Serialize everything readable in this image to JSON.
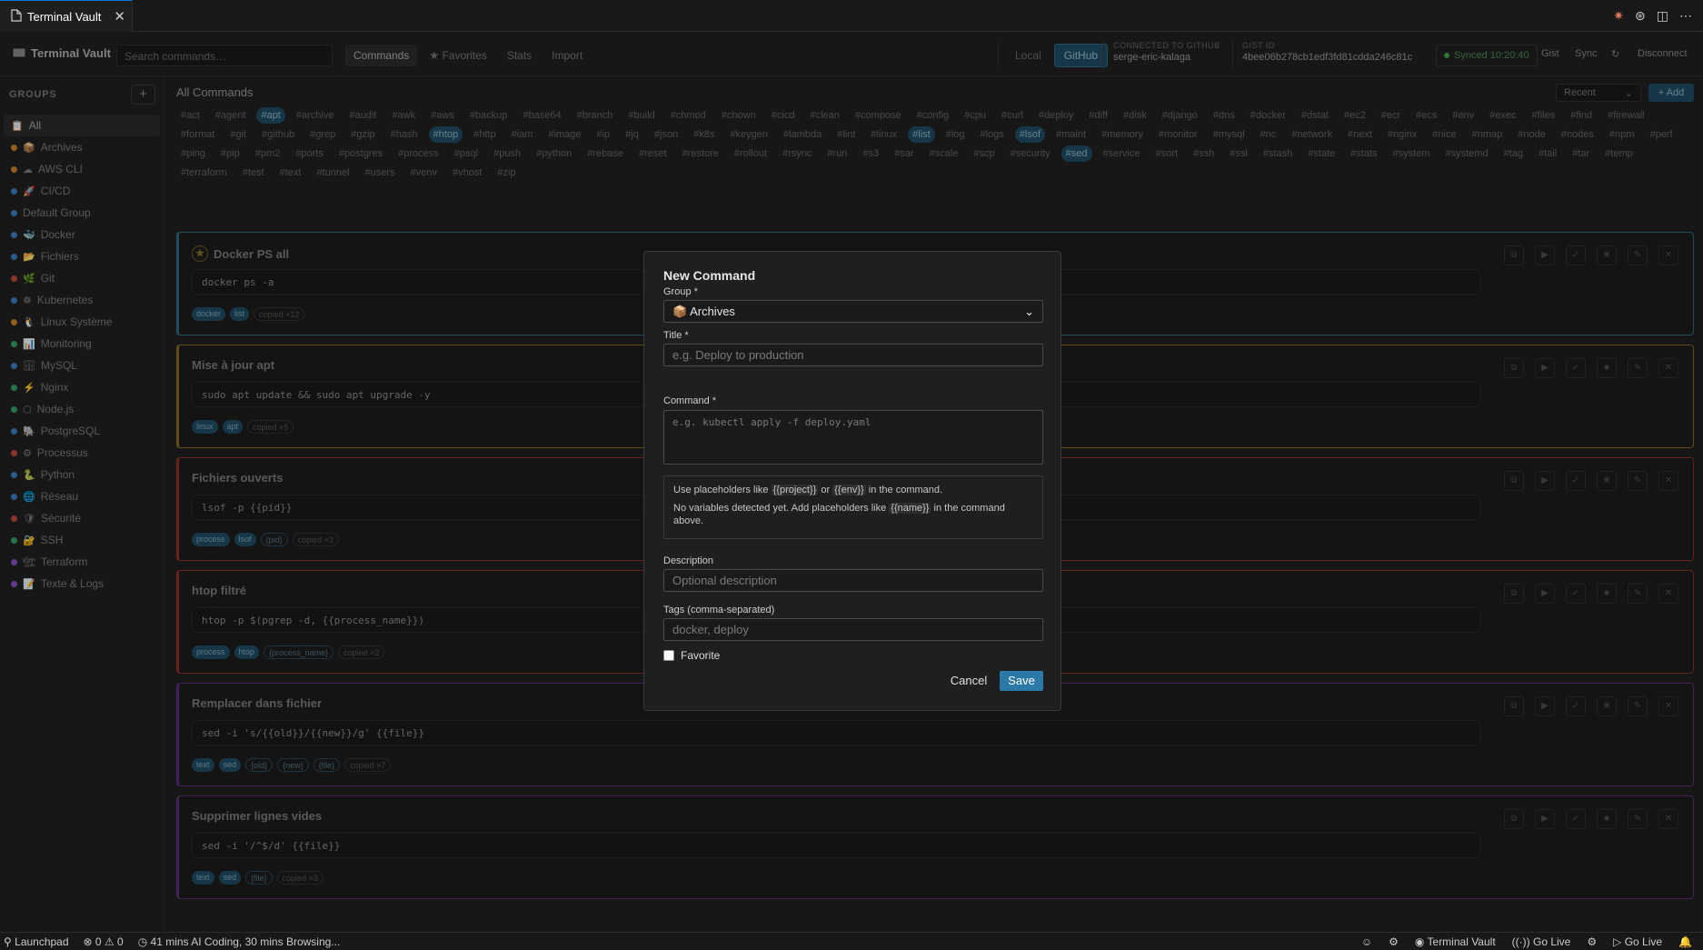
{
  "window": {
    "tab_title": "Terminal Vault",
    "tab_close": "✕"
  },
  "toolbar": {
    "brand": "Terminal Vault",
    "search_placeholder": "Search commands…",
    "tabs": [
      "Commands",
      "★ Favorites",
      "Stats",
      "Import"
    ],
    "modes": [
      "Local",
      "GitHub"
    ],
    "connected_label": "CONNECTED TO GITHUB",
    "connected_user": "serge-eric-kalaga",
    "gist_label": "GIST ID",
    "gist_id": "4bee06b278cb1edf3fd81cdda246c81c",
    "synced": "Synced 10:20:40",
    "actions": [
      "Gist",
      "Sync",
      "↻",
      "Disconnect"
    ]
  },
  "sidebar": {
    "heading": "GROUPS",
    "add": "+",
    "items": [
      {
        "label": "All",
        "icon": "📋",
        "color": ""
      },
      {
        "label": "Archives",
        "icon": "📦",
        "color": "#c9822b"
      },
      {
        "label": "AWS CLI",
        "icon": "☁",
        "color": "#c9822b"
      },
      {
        "label": "CI/CD",
        "icon": "🚀",
        "color": "#3d7ec2"
      },
      {
        "label": "Default Group",
        "icon": "",
        "color": "#3d7ec2"
      },
      {
        "label": "Docker",
        "icon": "🐳",
        "color": "#3d7ec2"
      },
      {
        "label": "Fichiers",
        "icon": "📂",
        "color": "#3d7ec2"
      },
      {
        "label": "Git",
        "icon": "🌿",
        "color": "#c04a3a"
      },
      {
        "label": "Kubernetes",
        "icon": "☸",
        "color": "#3d7ec2"
      },
      {
        "label": "Linux Système",
        "icon": "🐧",
        "color": "#c9822b"
      },
      {
        "label": "Monitoring",
        "icon": "📊",
        "color": "#3aa06a"
      },
      {
        "label": "MySQL",
        "icon": "🗄",
        "color": "#3d7ec2"
      },
      {
        "label": "Nginx",
        "icon": "⚡",
        "color": "#3aa06a"
      },
      {
        "label": "Node.js",
        "icon": "⬡",
        "color": "#3aa06a"
      },
      {
        "label": "PostgreSQL",
        "icon": "🐘",
        "color": "#3d7ec2"
      },
      {
        "label": "Processus",
        "icon": "⚙",
        "color": "#c04a3a"
      },
      {
        "label": "Python",
        "icon": "🐍",
        "color": "#3d7ec2"
      },
      {
        "label": "Réseau",
        "icon": "🌐",
        "color": "#3d7ec2"
      },
      {
        "label": "Sécurité",
        "icon": "🛡",
        "color": "#c04a3a"
      },
      {
        "label": "SSH",
        "icon": "🔐",
        "color": "#3aa06a"
      },
      {
        "label": "Terraform",
        "icon": "🏗",
        "color": "#8a4fc2"
      },
      {
        "label": "Texte & Logs",
        "icon": "📝",
        "color": "#8a4fc2"
      }
    ]
  },
  "main": {
    "title": "All Commands",
    "sort": "Recent",
    "add": "+ Add",
    "tags": [
      "#act",
      "#agent",
      "#apt",
      "#archive",
      "#audit",
      "#awk",
      "#aws",
      "#backup",
      "#base64",
      "#branch",
      "#build",
      "#chmod",
      "#chown",
      "#cicd",
      "#clean",
      "#compose",
      "#config",
      "#cpu",
      "#curl",
      "#deploy",
      "#diff",
      "#disk",
      "#django",
      "#dns",
      "#docker",
      "#dstat",
      "#ec2",
      "#ecr",
      "#ecs",
      "#env",
      "#exec",
      "#files",
      "#find",
      "#firewall",
      "#format",
      "#git",
      "#github",
      "#grep",
      "#gzip",
      "#hash",
      "#htop",
      "#http",
      "#iam",
      "#image",
      "#ip",
      "#jq",
      "#json",
      "#k8s",
      "#keygen",
      "#lambda",
      "#lint",
      "#linux",
      "#list",
      "#log",
      "#logs",
      "#lsof",
      "#maint",
      "#memory",
      "#monitor",
      "#mysql",
      "#nc",
      "#network",
      "#next",
      "#nginx",
      "#nice",
      "#nmap",
      "#node",
      "#nodes",
      "#npm",
      "#perf",
      "#ping",
      "#pip",
      "#pm2",
      "#ports",
      "#postgres",
      "#process",
      "#psql",
      "#push",
      "#python",
      "#rebase",
      "#reset",
      "#restore",
      "#rollout",
      "#rsync",
      "#run",
      "#s3",
      "#sar",
      "#scale",
      "#scp",
      "#security",
      "#sed",
      "#service",
      "#sort",
      "#ssh",
      "#ssl",
      "#stash",
      "#state",
      "#stats",
      "#system",
      "#systemd",
      "#tag",
      "#tail",
      "#tar",
      "#temp",
      "#terraform",
      "#test",
      "#text",
      "#tunnel",
      "#users",
      "#venv",
      "#vhost",
      "#zip"
    ],
    "selected_tags": [
      "#apt",
      "#htop",
      "#list",
      "#lsof",
      "#sed"
    ],
    "cards": [
      {
        "title": "Docker PS all",
        "fav": true,
        "accent": "#2c6a86",
        "cmd": "docker ps -a",
        "chips": [
          "docker",
          "list"
        ],
        "vars": [],
        "copied": "copied ×12"
      },
      {
        "title": "Mise à jour apt",
        "fav": false,
        "accent": "#8a6a1e",
        "cmd": "sudo apt update && sudo apt upgrade -y",
        "chips": [
          "linux",
          "apt"
        ],
        "vars": [],
        "copied": "copied ×5"
      },
      {
        "title": "Fichiers ouverts",
        "fav": false,
        "accent": "#8a3324",
        "cmd": "lsof -p {{pid}}",
        "chips": [
          "process",
          "lsof"
        ],
        "vars": [
          "{pid}"
        ],
        "copied": "copied ×3"
      },
      {
        "title": "htop filtré",
        "fav": false,
        "accent": "#8a3324",
        "cmd": "htop -p $(pgrep -d, {{process_name}})",
        "chips": [
          "process",
          "htop"
        ],
        "vars": [
          "{process_name}"
        ],
        "copied": "copied ×2"
      },
      {
        "title": "Remplacer dans fichier",
        "fav": false,
        "accent": "#5e2e7a",
        "cmd": "sed -i 's/{{old}}/{{new}}/g' {{file}}",
        "chips": [
          "text",
          "sed"
        ],
        "vars": [
          "{old}",
          "{new}",
          "{file}"
        ],
        "copied": "copied ×7"
      },
      {
        "title": "Supprimer lignes vides",
        "fav": false,
        "accent": "#5e2e7a",
        "cmd": "sed -i '/^$/d' {{file}}",
        "chips": [
          "text",
          "sed"
        ],
        "vars": [
          "{file}"
        ],
        "copied": "copied ×3"
      }
    ]
  },
  "modal": {
    "title": "New Command",
    "group_label": "Group *",
    "group_value": "📦 Archives",
    "title_label": "Title *",
    "title_placeholder": "e.g. Deploy to production",
    "command_label": "Command *",
    "command_placeholder": "e.g. kubectl apply -f deploy.yaml",
    "hint_pre": "Use placeholders like",
    "hint_ph1": "{{project}}",
    "hint_or": "or",
    "hint_ph2": "{{env}}",
    "hint_post": "in the command.",
    "hint2_pre": "No variables detected yet. Add placeholders like",
    "hint2_ph": "{{name}}",
    "hint2_post": "in the command above.",
    "desc_label": "Description",
    "desc_placeholder": "Optional description",
    "tags_label": "Tags (comma-separated)",
    "tags_placeholder": "docker, deploy",
    "favorite_label": "Favorite",
    "cancel": "Cancel",
    "save": "Save"
  },
  "statusbar": {
    "launchpad": "Launchpad",
    "problems": "⊗ 0 ⚠ 0",
    "activity": "41 mins AI Coding, 30 mins Browsing...",
    "terminal_vault": "Terminal Vault",
    "go_live_1": "Go Live",
    "go_live_2": "Go Live"
  }
}
